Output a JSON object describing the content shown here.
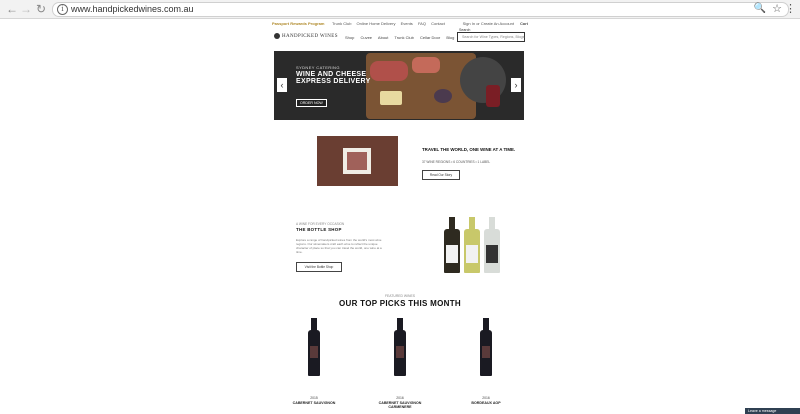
{
  "browser": {
    "url": "www.handpickedwines.com.au",
    "back_icon": "arrow-left",
    "forward_icon": "arrow-right",
    "reload_icon": "reload"
  },
  "topbar": {
    "passport": "Passport Rewards Program",
    "links": [
      "Trunk Club",
      "Online Home Delivery",
      "Events",
      "FAQ",
      "Contact"
    ],
    "account": "Sign In or Create An Account",
    "cart": "Cart"
  },
  "header": {
    "logo": "HANDPICKED WINES",
    "nav": [
      "Shop",
      "Cuvee",
      "About",
      "Trunk Club",
      "Cellar Door",
      "Blog"
    ],
    "search_label": "Search",
    "search_placeholder": "Search for Wine Types, Regions, Blogs"
  },
  "hero": {
    "kicker": "SYDNEY CATERING",
    "title": "WINE AND CHEESE EXPRESS DELIVERY",
    "button": "ORDER NOW"
  },
  "travel": {
    "title": "TRAVEL THE WORLD, ONE WINE AT A TIME.",
    "subtitle": "37 WINE REGIONS • 6 COUNTRIES • 1 LABEL",
    "button": "Read Our Story"
  },
  "bottle_shop": {
    "kicker": "A WINE FOR EVERY OCCASION",
    "title": "THE BOTTLE SHOP",
    "description": "Explore a range of handpicked wines from the world's most wine regions. Our winemakers craft each wine to reflect the unique character of place so that you can travel the world, one wine at a time.",
    "button": "Visit the Bottle Shop"
  },
  "picks": {
    "kicker": "FEATURED WINES",
    "title": "OUR TOP PICKS THIS MONTH",
    "items": [
      {
        "year": "2015",
        "name": "CABERNET SAUVIGNON"
      },
      {
        "year": "2016",
        "name": "CABERNET SAUVIGNON CARMENERE"
      },
      {
        "year": "2016",
        "name": "BORDEAUX AOP"
      }
    ]
  },
  "chat": {
    "label": "Leave a message"
  }
}
